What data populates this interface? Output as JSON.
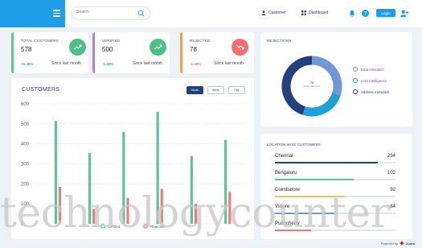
{
  "header": {
    "search_placeholder": "Search",
    "links": [
      "Customer",
      "Dashboard"
    ],
    "login_label": "Login"
  },
  "stats": [
    {
      "title": "TOTAL CUSTOMERS",
      "value": "578",
      "change": "+0.48%",
      "subtext": "Since last month",
      "color": "#5cc98c",
      "icon": "trending-up-icon"
    },
    {
      "title": "VERIFIED",
      "value": "500",
      "change": "-1.48%",
      "subtext": "Since last month",
      "color": "#b87fd0",
      "icon": "trending-up-icon"
    },
    {
      "title": "REJECTED",
      "value": "78",
      "change": "-1.48%",
      "subtext": "Since last month",
      "color": "#f3a24a",
      "icon": "trending-down-icon"
    }
  ],
  "customers": {
    "title": "CUSTOMERS",
    "ranges": [
      "Month",
      "Week",
      "Day"
    ],
    "active_range": "Month",
    "legend": [
      "Verified",
      "Rejected"
    ]
  },
  "chart_data": {
    "type": "bar",
    "title": "CUSTOMERS",
    "categories": [
      "",
      "",
      "",
      "",
      "",
      "",
      ""
    ],
    "series": [
      {
        "name": "Verified",
        "color": "#5cc49a",
        "values": [
          515,
          355,
          460,
          560,
          340,
          420
        ]
      },
      {
        "name": "Rejected",
        "color": "#f07b7e",
        "values": [
          185,
          75,
          130,
          175,
          100,
          160
        ]
      }
    ],
    "yticks": [
      0,
      100,
      200,
      300,
      400,
      500,
      600
    ],
    "ylim": [
      0,
      600
    ],
    "grid": true,
    "legend_position": "bottom"
  },
  "rejections": {
    "title": "REJECTIONS",
    "center_value": "78",
    "center_label": "Total customers",
    "items": [
      {
        "label": "Data mismatch",
        "color": "#7098d6",
        "value": 30
      },
      {
        "label": "Less Intelligence",
        "color": "#1ea0d8",
        "value": 25
      },
      {
        "label": "Address mismatch",
        "color": "#23407e",
        "value": 45
      }
    ]
  },
  "locations": {
    "title": "LOCATION WISE CUSTOMERS",
    "items": [
      {
        "name": "Chennai",
        "value": "234",
        "fraction": 0.85,
        "color": "#23407e"
      },
      {
        "name": "Bengaluru",
        "value": "102",
        "fraction": 0.65,
        "color": "#5cc49a"
      },
      {
        "name": "Coimbatore",
        "value": "92",
        "fraction": 0.58,
        "color": "#f3c06e"
      },
      {
        "name": "Vellore",
        "value": "84",
        "fraction": 0.5,
        "color": "#7098d6"
      },
      {
        "name": "Puducherry",
        "value": "",
        "fraction": 0.3,
        "color": "#f07b7e"
      }
    ]
  },
  "watermark": "technologycounter",
  "footer": {
    "label": "Powered by",
    "brand": "Zuora"
  }
}
